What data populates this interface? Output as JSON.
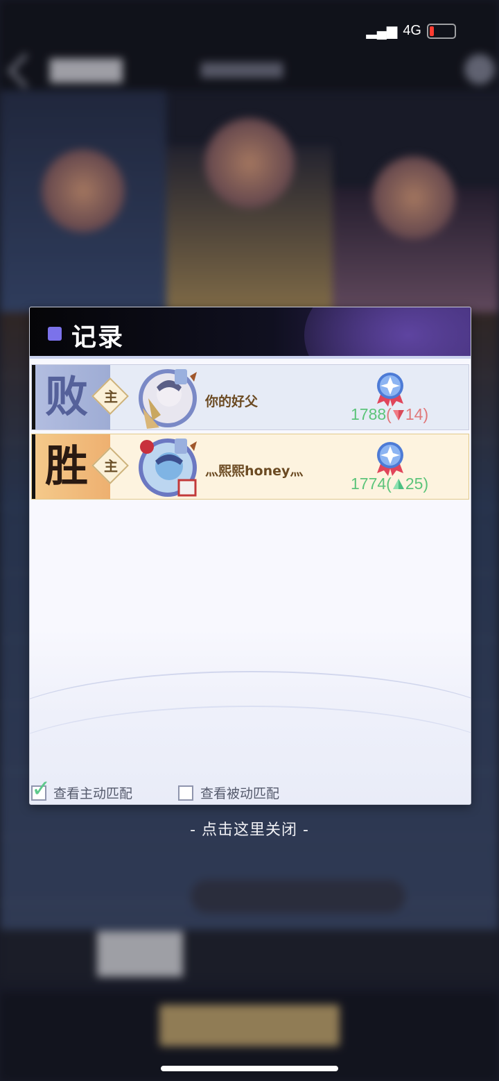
{
  "status_bar": {
    "network": "4G"
  },
  "dialog": {
    "title": "记录",
    "records": [
      {
        "result": "败",
        "role": "主",
        "player_name": "你的好父",
        "score": "1788",
        "delta": "14",
        "direction": "down"
      },
      {
        "result": "胜",
        "role": "主",
        "player_name": "灬熙熙honey灬",
        "score": "1774",
        "delta": "25",
        "direction": "up"
      }
    ],
    "filters": {
      "active": {
        "label": "查看主动匹配",
        "checked": true
      },
      "passive": {
        "label": "查看被动匹配",
        "checked": false
      }
    }
  },
  "close_hint": "- 点击这里关闭 -",
  "colors": {
    "accent_purple": "#7b72ea",
    "score_green": "#5cc47a",
    "delta_down_red": "#e0787a"
  }
}
